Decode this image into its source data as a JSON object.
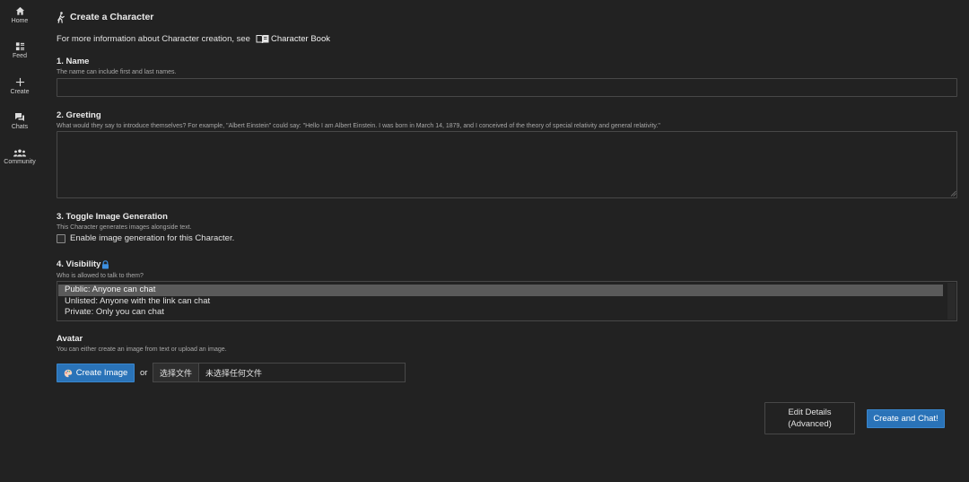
{
  "sidebar": {
    "items": [
      {
        "label": "Home",
        "icon": "home-icon"
      },
      {
        "label": "Feed",
        "icon": "feed-icon"
      },
      {
        "label": "Create",
        "icon": "plus-icon"
      },
      {
        "label": "Chats",
        "icon": "chat-bubbles-icon"
      },
      {
        "label": "Community",
        "icon": "community-icon"
      }
    ]
  },
  "header": {
    "title": "Create a Character",
    "info_text": "For more information about Character creation, see",
    "info_link": "Character Book"
  },
  "name_section": {
    "label": "1. Name",
    "help": "The name can include first and last names.",
    "value": "",
    "placeholder": ""
  },
  "greeting_section": {
    "label": "2. Greeting",
    "help": "What would they say to introduce themselves? For example, \"Albert Einstein\" could say: \"Hello I am Albert Einstein. I was born in March 14, 1879, and I conceived of the theory of special relativity and general relativity.\"",
    "value": "",
    "placeholder": ""
  },
  "image_gen_section": {
    "label": "3. Toggle Image Generation",
    "help": "This Character generates images alongside text.",
    "checkbox_label": "Enable image generation for this Character.",
    "checked": false
  },
  "visibility_section": {
    "label": "4. Visibility",
    "help": "Who is allowed to talk to them?",
    "options": [
      "Public: Anyone can chat",
      "Unlisted: Anyone with the link can chat",
      "Private: Only you can chat"
    ],
    "selected_index": 0
  },
  "avatar_section": {
    "label": "Avatar",
    "help": "You can either create an image from text or upload an image.",
    "create_image_label": "Create Image",
    "or_text": "or",
    "file_choose_label": "选择文件",
    "file_status": "未选择任何文件"
  },
  "footer": {
    "edit_details_line1": "Edit Details",
    "edit_details_line2": "(Advanced)",
    "create_chat_label": "Create and Chat!"
  },
  "colors": {
    "background": "#222222",
    "accent": "#2a73b8",
    "border": "#484848",
    "selected_option": "#5a5a5a",
    "lock_icon": "#3d8fe0"
  }
}
